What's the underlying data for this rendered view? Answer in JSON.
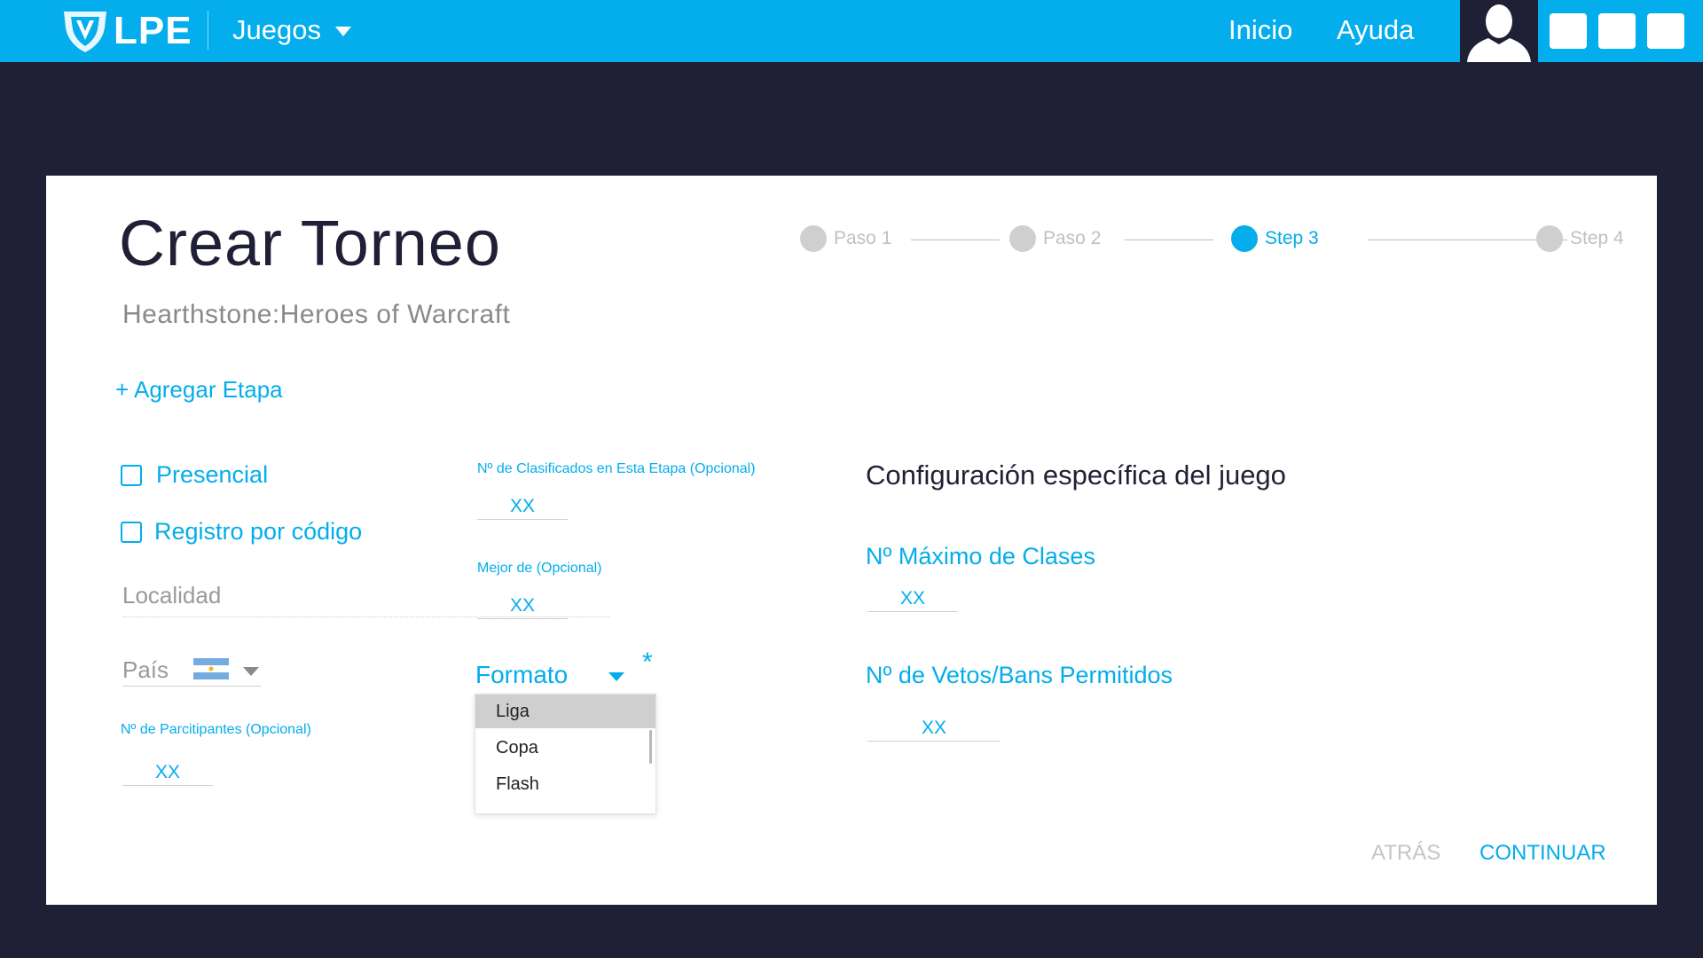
{
  "header": {
    "logo_text": "LPE",
    "games_label": "Juegos",
    "nav": {
      "home": "Inicio",
      "help": "Ayuda"
    }
  },
  "page": {
    "title": "Crear Torneo",
    "subtitle": "Hearthstone:Heroes of Warcraft",
    "add_stage": "+ Agregar Etapa"
  },
  "stepper": {
    "steps": [
      {
        "label": "Paso 1",
        "active": false
      },
      {
        "label": "Paso 2",
        "active": false
      },
      {
        "label": "Step 3",
        "active": true
      },
      {
        "label": "Step 4",
        "active": false
      }
    ]
  },
  "form": {
    "presencial_label": "Presencial",
    "presencial_checked": false,
    "registro_label": "Registro por código",
    "registro_checked": false,
    "localidad_placeholder": "Localidad",
    "pais_label": "País",
    "pais_flag": "argentina-flag",
    "participants_label": "Nº de Parcitipantes (Opcional)",
    "participants_value": "XX",
    "qualified_label": "Nº de Clasificados en Esta Etapa (Opcional)",
    "qualified_value": "XX",
    "best_of_label": "Mejor de (Opcional)",
    "best_of_value": "XX",
    "format_label": "Formato",
    "required_mark": "*",
    "format_options": [
      {
        "label": "Liga",
        "selected": true
      },
      {
        "label": "Copa",
        "selected": false
      },
      {
        "label": "Flash",
        "selected": false
      }
    ]
  },
  "game_config": {
    "title": "Configuración específica del juego",
    "max_classes_label": "Nº Máximo de Clases",
    "max_classes_value": "XX",
    "bans_label": "Nº de Vetos/Bans Permitidos",
    "bans_value": "XX"
  },
  "actions": {
    "back": "ATRÁS",
    "continue": "CONTINUAR"
  },
  "colors": {
    "accent": "#04adeb",
    "dark": "#1f2035",
    "muted": "#9a9a9a"
  }
}
